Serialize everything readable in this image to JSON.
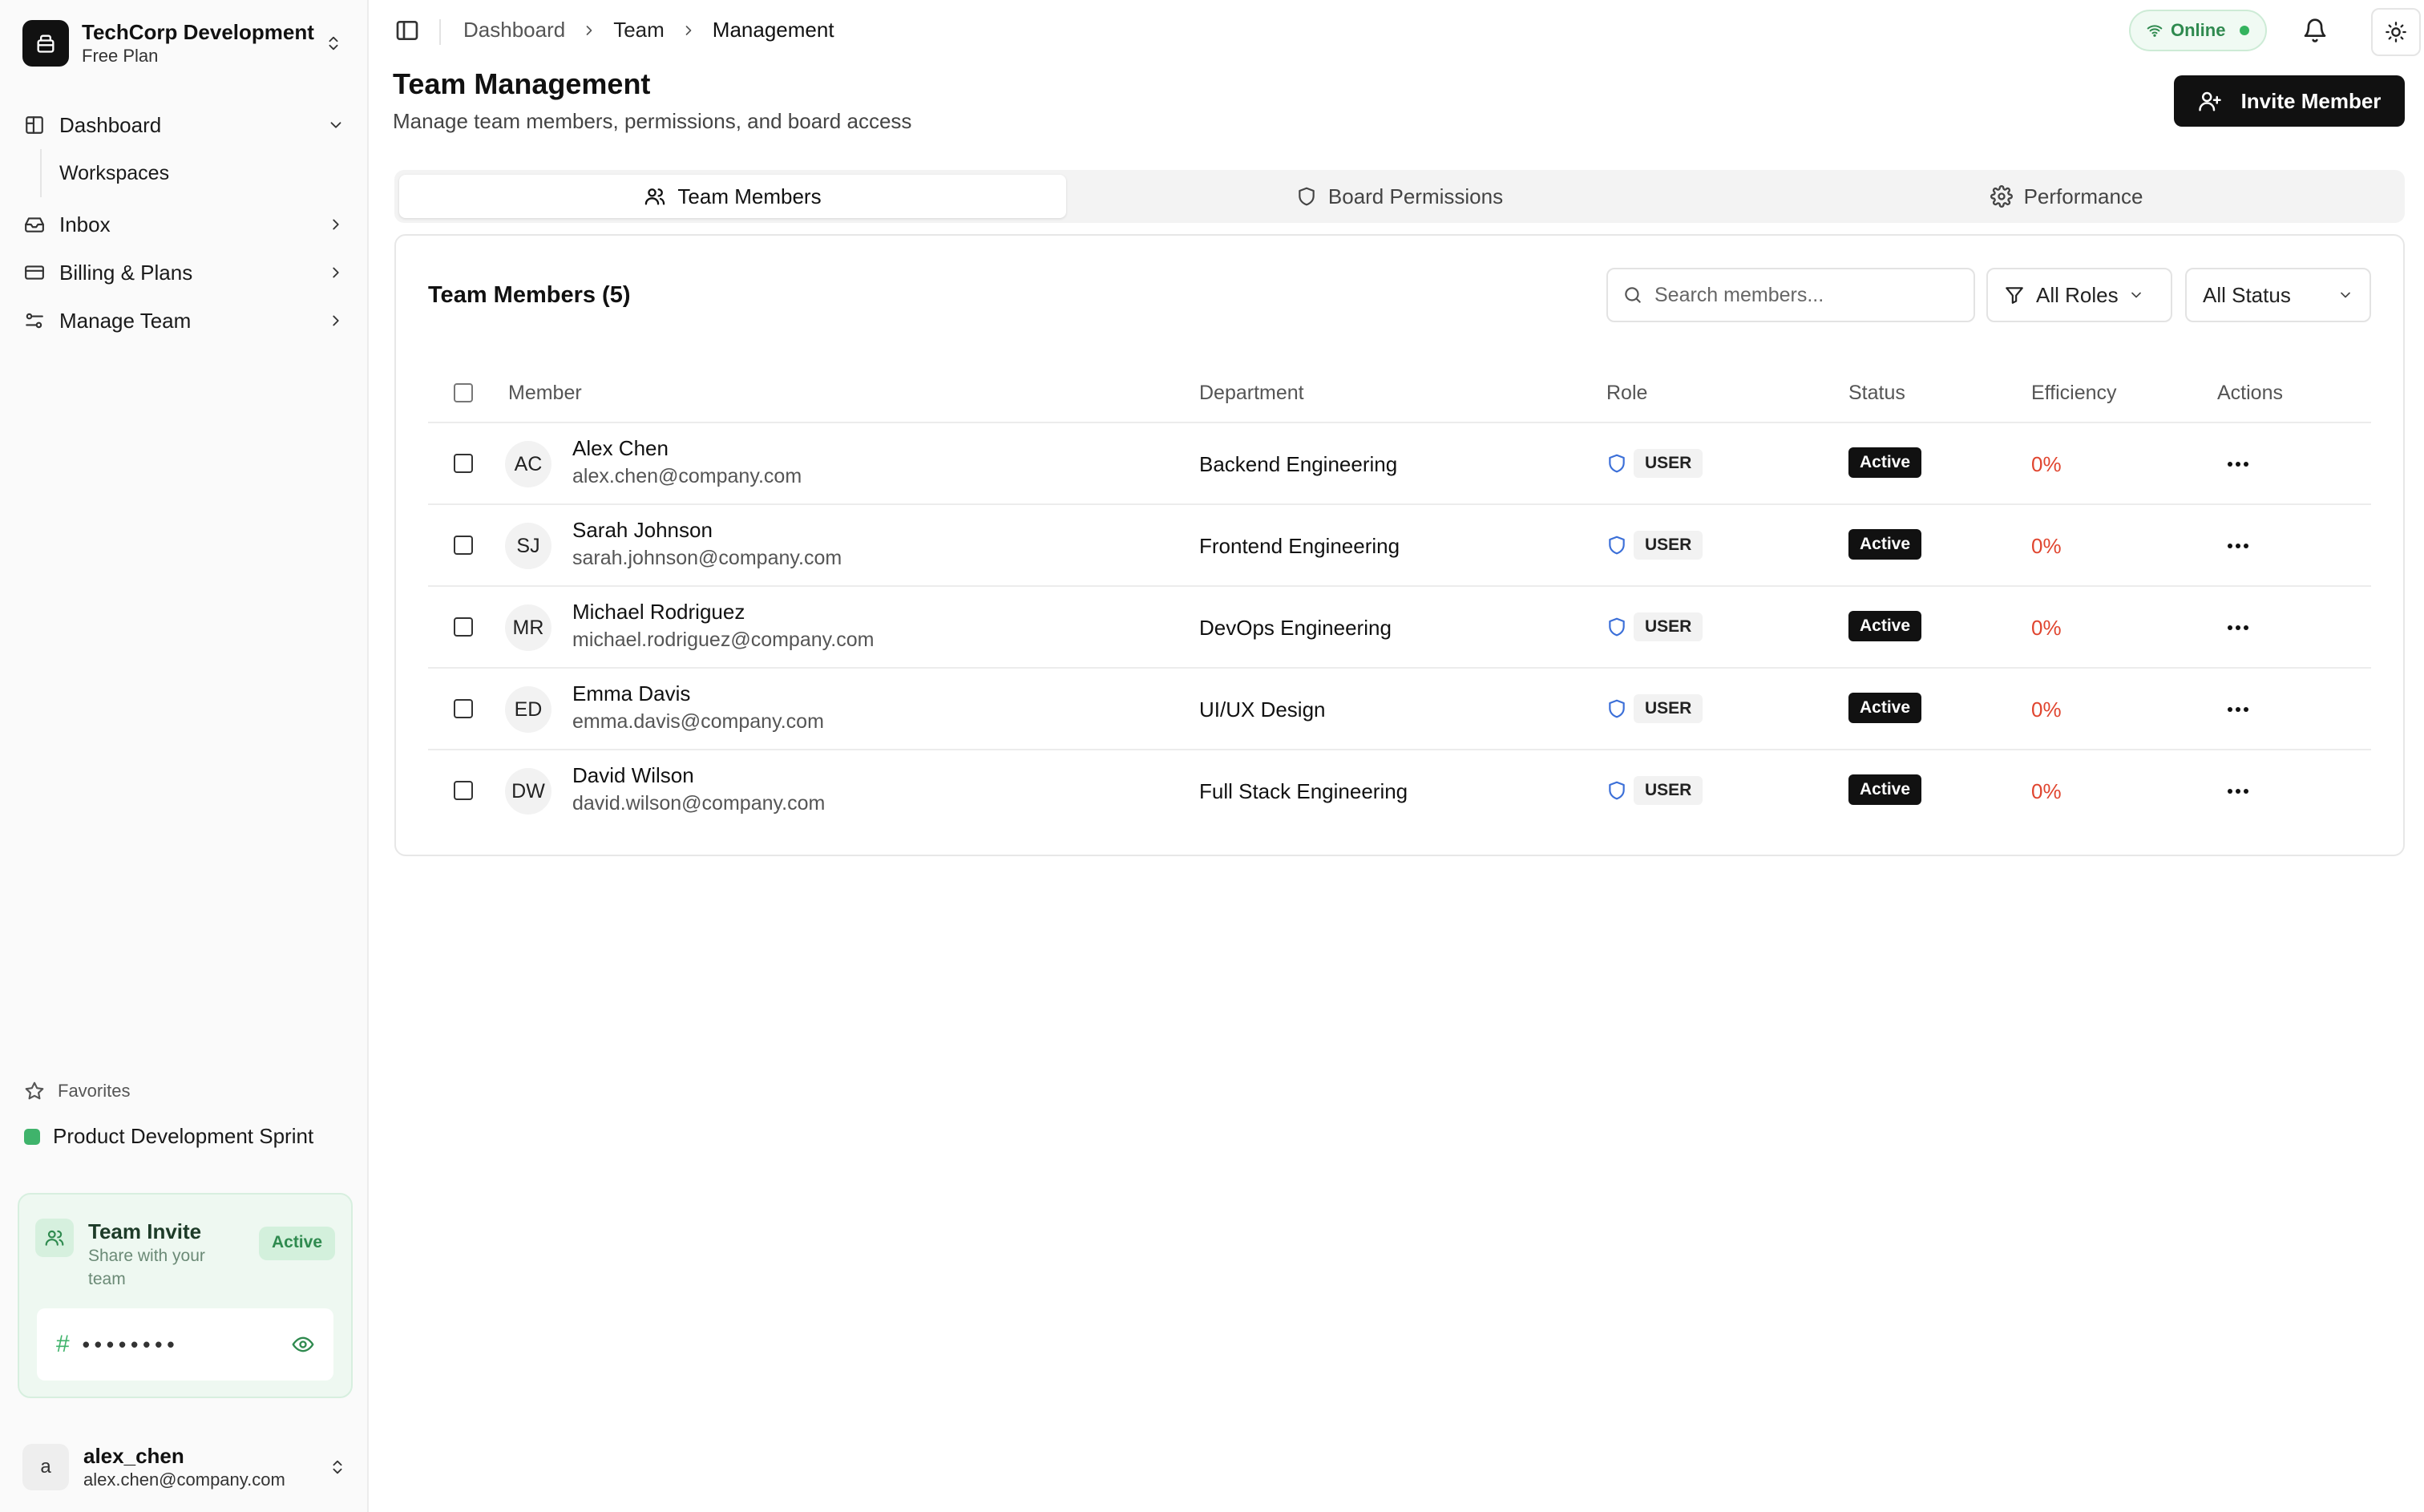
{
  "org": {
    "name": "TechCorp Development",
    "plan": "Free Plan"
  },
  "sidebar": {
    "items": [
      {
        "label": "Dashboard",
        "icon": "dashboard-icon"
      },
      {
        "label": "Inbox",
        "icon": "inbox-icon"
      },
      {
        "label": "Billing & Plans",
        "icon": "credit-card-icon"
      },
      {
        "label": "Manage Team",
        "icon": "team-settings-icon"
      }
    ],
    "subitems": [
      {
        "label": "Workspaces"
      }
    ],
    "favorites_label": "Favorites",
    "favorites": [
      {
        "label": "Product Development Sprint",
        "color": "#3fb36b"
      }
    ]
  },
  "invite_card": {
    "title": "Team Invite",
    "subtitle": "Share with your team",
    "badge": "Active",
    "hash": "#",
    "code_masked": "••••••••"
  },
  "user": {
    "avatar": "a",
    "name": "alex_chen",
    "email": "alex.chen@company.com"
  },
  "breadcrumb": [
    "Dashboard",
    "Team",
    "Management"
  ],
  "status_indicator": {
    "label": "Online",
    "color": "#34b35e"
  },
  "page": {
    "title": "Team Management",
    "subtitle": "Manage team members, permissions, and board access",
    "invite_button": "Invite Member"
  },
  "tabs": [
    {
      "label": "Team Members",
      "icon": "users-icon",
      "active": true
    },
    {
      "label": "Board Permissions",
      "icon": "shield-icon",
      "active": false
    },
    {
      "label": "Performance",
      "icon": "gear-icon",
      "active": false
    }
  ],
  "members_card": {
    "title": "Team Members (5)",
    "search_placeholder": "Search members...",
    "roles_filter": "All Roles",
    "status_filter": "All Status",
    "columns": [
      "Member",
      "Department",
      "Role",
      "Status",
      "Efficiency",
      "Actions"
    ],
    "rows": [
      {
        "initials": "AC",
        "name": "Alex Chen",
        "email": "alex.chen@company.com",
        "department": "Backend Engineering",
        "role": "USER",
        "status": "Active",
        "efficiency": "0%"
      },
      {
        "initials": "SJ",
        "name": "Sarah Johnson",
        "email": "sarah.johnson@company.com",
        "department": "Frontend Engineering",
        "role": "USER",
        "status": "Active",
        "efficiency": "0%"
      },
      {
        "initials": "MR",
        "name": "Michael Rodriguez",
        "email": "michael.rodriguez@company.com",
        "department": "DevOps Engineering",
        "role": "USER",
        "status": "Active",
        "efficiency": "0%"
      },
      {
        "initials": "ED",
        "name": "Emma Davis",
        "email": "emma.davis@company.com",
        "department": "UI/UX Design",
        "role": "USER",
        "status": "Active",
        "efficiency": "0%"
      },
      {
        "initials": "DW",
        "name": "David Wilson",
        "email": "david.wilson@company.com",
        "department": "Full Stack Engineering",
        "role": "USER",
        "status": "Active",
        "efficiency": "0%"
      }
    ]
  },
  "colors": {
    "accent_green": "#3fb36b",
    "efficiency_red": "#e0452f",
    "role_icon_blue": "#3b6fd8"
  }
}
